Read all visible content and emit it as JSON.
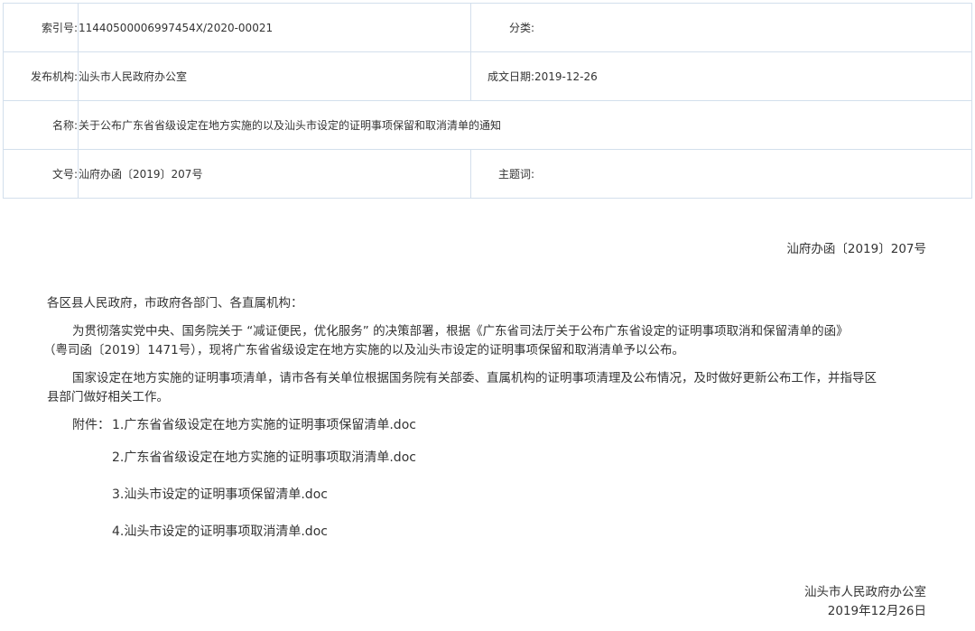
{
  "meta": {
    "index_label": "索引号:",
    "index_value": "11440500006997454X/2020-00021",
    "category_label": "分类:",
    "category_value": "",
    "publisher_label": "发布机构:",
    "publisher_value": "汕头市人民政府办公室",
    "date_label": "成文日期:",
    "date_value": "2019-12-26",
    "name_label": "名称:",
    "name_value": "关于公布广东省省级设定在地方实施的以及汕头市设定的证明事项保留和取消清单的通知",
    "docno_label": "文号:",
    "docno_value": "汕府办函〔2019〕207号",
    "subject_label": "主题词:",
    "subject_value": ""
  },
  "body": {
    "doc_number": "汕府办函〔2019〕207号",
    "salutation": "各区县人民政府，市政府各部门、各直属机构：",
    "para1_line1": "为贯彻落实党中央、国务院关于 “减证便民，优化服务” 的决策部署，根据《广东省司法厅关于公布广东省设定的证明事项取消和保留清单的函》",
    "para1_line2": "（粤司函〔2019〕1471号），现将广东省省级设定在地方实施的以及汕头市设定的证明事项保留和取消清单予以公布。",
    "para2_line1": "国家设定在地方实施的证明事项清单，请市各有关单位根据国务院有关部委、直属机构的证明事项清理及公布情况，及时做好更新公布工作，并指导区",
    "para2_line2": "县部门做好相关工作。",
    "attachments_label": "附件：",
    "attachments": [
      "1.广东省省级设定在地方实施的证明事项保留清单.doc",
      "2.广东省省级设定在地方实施的证明事项取消清单.doc",
      "3.汕头市设定的证明事项保留清单.doc",
      "4.汕头市设定的证明事项取消清单.doc"
    ],
    "signature": "汕头市人民政府办公室",
    "sign_date": "2019年12月26日"
  }
}
